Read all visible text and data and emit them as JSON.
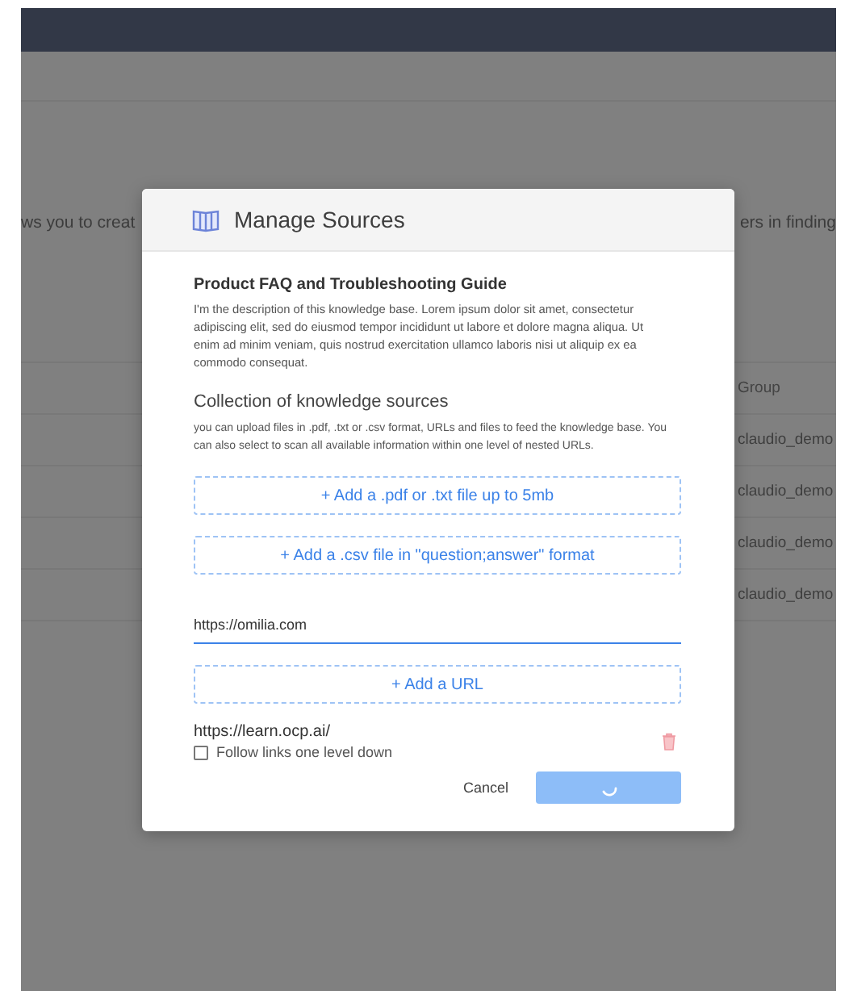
{
  "background": {
    "intro_text_left": "ws you to creat",
    "intro_text_right": "ers in finding",
    "table": {
      "columns": [
        "Group"
      ],
      "rows": [
        {
          "group": "claudio_demo"
        },
        {
          "group": "claudio_demo"
        },
        {
          "group": "claudio_demo"
        },
        {
          "group": "claudio_demo"
        }
      ]
    }
  },
  "modal": {
    "title": "Manage Sources",
    "kb_name": "Product FAQ and Troubleshooting Guide",
    "kb_description": "I'm the description of this knowledge base. Lorem ipsum dolor sit amet, consectetur adipiscing elit, sed do eiusmod tempor incididunt ut labore et dolore magna aliqua. Ut enim ad minim veniam, quis nostrud exercitation ullamco laboris nisi ut aliquip ex ea commodo consequat.",
    "section_title": "Collection of knowledge sources",
    "section_help": "you can upload files in .pdf, .txt or .csv format, URLs and files to feed the knowledge base. You can also select to scan all available information within one level of nested URLs.",
    "upload_buttons": [
      "+ Add a .pdf or .txt file up to 5mb",
      "+ Add a .csv file in \"question;answer\" format"
    ],
    "url_input": {
      "value": "https://omilia.com"
    },
    "add_url_button": "+  Add a URL",
    "sources": [
      {
        "url": "https://learn.ocp.ai/",
        "follow_label": "Follow links one level down",
        "checked": false
      }
    ],
    "cancel_button": "Cancel",
    "submit_button": {
      "loading": true
    }
  }
}
